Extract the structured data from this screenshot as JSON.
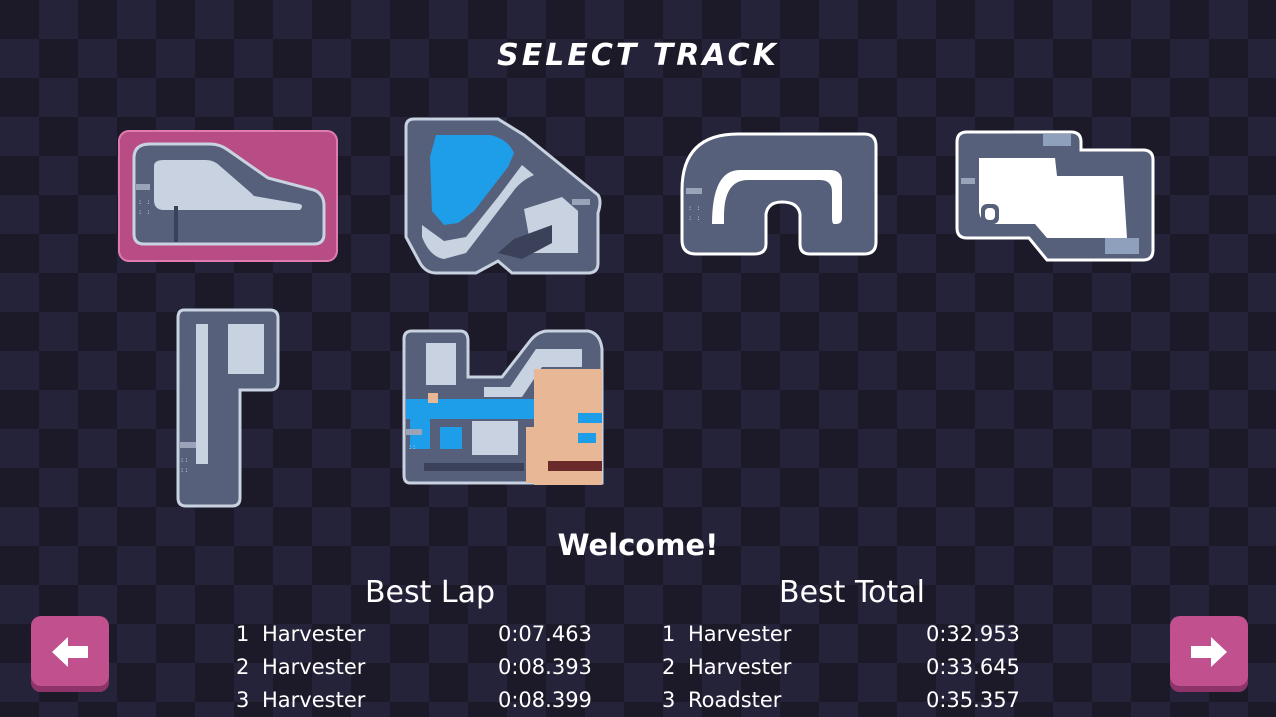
{
  "screen": {
    "title": "SELECT TRACK",
    "welcome": "Welcome!"
  },
  "tracks": [
    {
      "id": "track-1",
      "selected": true
    },
    {
      "id": "track-2",
      "selected": false
    },
    {
      "id": "track-3",
      "selected": false
    },
    {
      "id": "track-4",
      "selected": false
    },
    {
      "id": "track-5",
      "selected": false
    },
    {
      "id": "track-6",
      "selected": false
    }
  ],
  "leaderboard": {
    "best_lap": {
      "heading": "Best Lap",
      "rows": [
        {
          "rank": "1",
          "name": "Harvester",
          "time": "0:07.463"
        },
        {
          "rank": "2",
          "name": "Harvester",
          "time": "0:08.393"
        },
        {
          "rank": "3",
          "name": "Harvester",
          "time": "0:08.399"
        }
      ]
    },
    "best_total": {
      "heading": "Best Total",
      "rows": [
        {
          "rank": "1",
          "name": "Harvester",
          "time": "0:32.953"
        },
        {
          "rank": "2",
          "name": "Harvester",
          "time": "0:33.645"
        },
        {
          "rank": "3",
          "name": "Roadster",
          "time": "0:35.357"
        }
      ]
    }
  },
  "navigation": {
    "prev_icon": "arrow-left-icon",
    "next_icon": "arrow-right-icon"
  },
  "colors": {
    "background": "#1c1a29",
    "checker": "#25233a",
    "track_road": "#56607a",
    "track_border": "#c8d2e0",
    "infield": "#c8d2e0",
    "water": "#1e9ee8",
    "sand": "#e8b896",
    "selected_highlight": "#b84d86",
    "button": "#c0508e"
  }
}
